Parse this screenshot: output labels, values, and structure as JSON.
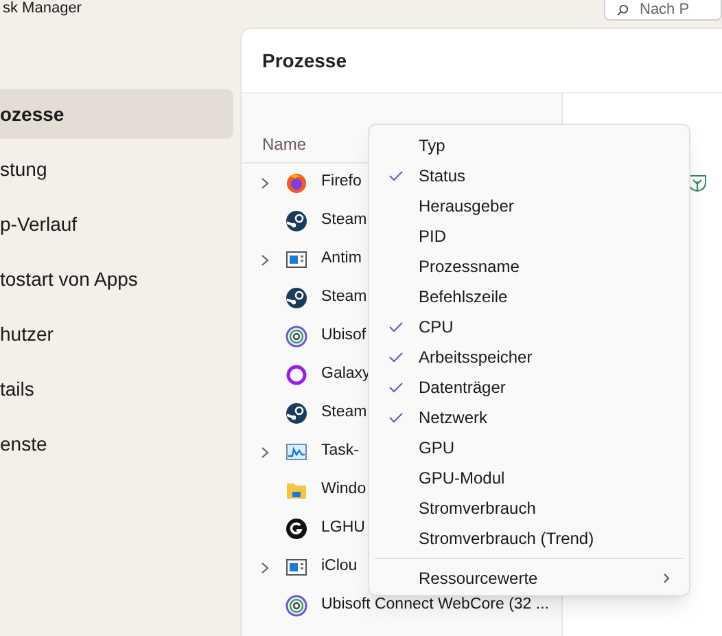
{
  "window": {
    "title": "sk Manager",
    "search": {
      "placeholder": "Nach P"
    }
  },
  "sidebar": {
    "items": [
      {
        "label": "ozesse",
        "selected": true
      },
      {
        "label": "stung",
        "selected": false
      },
      {
        "label": "p-Verlauf",
        "selected": false
      },
      {
        "label": "tostart von Apps",
        "selected": false
      },
      {
        "label": "hutzer",
        "selected": false
      },
      {
        "label": "tails",
        "selected": false
      },
      {
        "label": "enste",
        "selected": false
      }
    ]
  },
  "page": {
    "title": "Prozesse"
  },
  "table": {
    "columns": [
      "Name"
    ],
    "rows": [
      {
        "name": "Firefo",
        "kind": "firefox",
        "expandable": true,
        "efficiency": true
      },
      {
        "name": "Steam",
        "kind": "steam",
        "expandable": false,
        "efficiency": false
      },
      {
        "name": "Antim",
        "kind": "window",
        "expandable": true,
        "efficiency": false
      },
      {
        "name": "Steam",
        "kind": "steam",
        "expandable": false,
        "efficiency": false
      },
      {
        "name": "Ubisof",
        "kind": "ubisoft",
        "expandable": false,
        "efficiency": false
      },
      {
        "name": "Galaxy",
        "kind": "ring",
        "expandable": false,
        "efficiency": false
      },
      {
        "name": "Steam",
        "kind": "steam",
        "expandable": false,
        "efficiency": false
      },
      {
        "name": "Task-",
        "kind": "chart",
        "expandable": true,
        "efficiency": false
      },
      {
        "name": "Windo",
        "kind": "folder",
        "expandable": false,
        "efficiency": false
      },
      {
        "name": "LGHU",
        "kind": "g",
        "expandable": false,
        "efficiency": false
      },
      {
        "name": "iClou",
        "kind": "window",
        "expandable": true,
        "efficiency": false
      },
      {
        "name": "Ubisoft Connect WebCore (32 ...",
        "kind": "ubisoft",
        "expandable": false,
        "efficiency": false
      }
    ]
  },
  "context_menu": {
    "items": [
      {
        "label": "Typ",
        "checked": false
      },
      {
        "label": "Status",
        "checked": true
      },
      {
        "label": "Herausgeber",
        "checked": false
      },
      {
        "label": "PID",
        "checked": false
      },
      {
        "label": "Prozessname",
        "checked": false
      },
      {
        "label": "Befehlszeile",
        "checked": false
      },
      {
        "label": "CPU",
        "checked": true
      },
      {
        "label": "Arbeitsspeicher",
        "checked": true
      },
      {
        "label": "Datenträger",
        "checked": true
      },
      {
        "label": "Netzwerk",
        "checked": true
      },
      {
        "label": "GPU",
        "checked": false
      },
      {
        "label": "GPU-Modul",
        "checked": false
      },
      {
        "label": "Stromverbrauch",
        "checked": false
      },
      {
        "label": "Stromverbrauch (Trend)",
        "checked": false
      }
    ],
    "submenu": {
      "label": "Ressourcewerte"
    }
  }
}
